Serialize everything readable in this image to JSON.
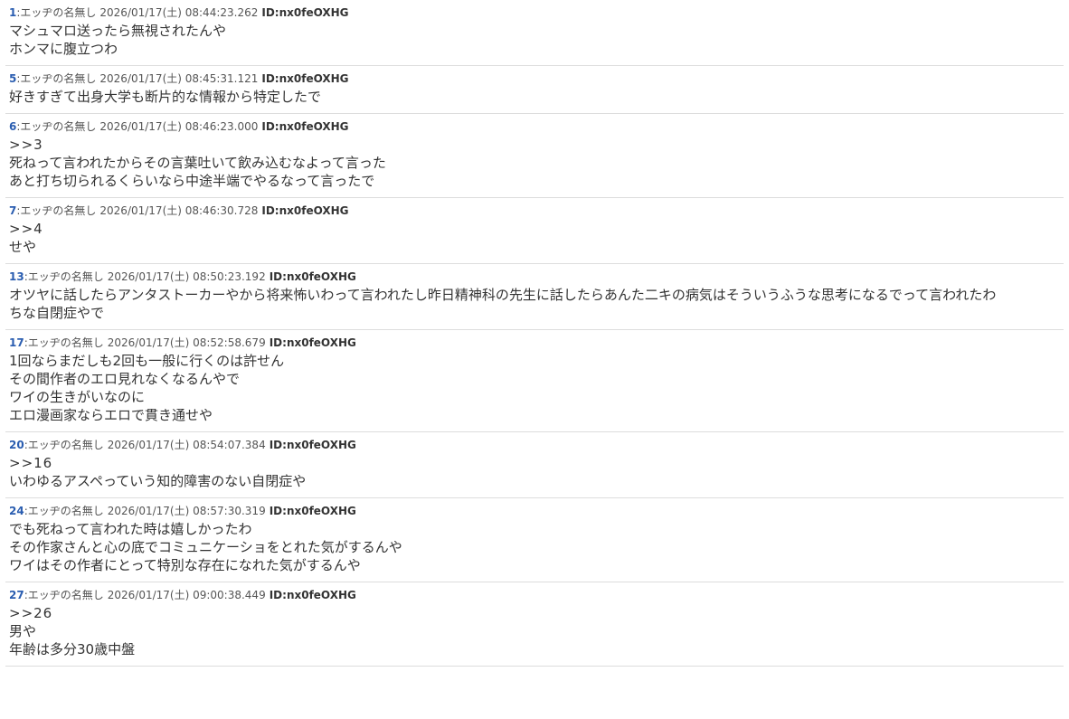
{
  "thread": {
    "posts": [
      {
        "number": "1",
        "name": ":エッヂの名無し",
        "date": "2026/01/17(土) 08:44:23.262",
        "id": "ID:nx0feOXHG",
        "lines": [
          "マシュマロ送ったら無視されたんや",
          "ホンマに腹立つわ"
        ]
      },
      {
        "number": "5",
        "name": ":エッヂの名無し",
        "date": "2026/01/17(土) 08:45:31.121",
        "id": "ID:nx0feOXHG",
        "lines": [
          "好きすぎて出身大学も断片的な情報から特定したで"
        ]
      },
      {
        "number": "6",
        "name": ":エッヂの名無し",
        "date": "2026/01/17(土) 08:46:23.000",
        "id": "ID:nx0feOXHG",
        "lines": [
          ">>3",
          "死ねって言われたからその言葉吐いて飲み込むなよって言った",
          "あと打ち切られるくらいなら中途半端でやるなって言ったで"
        ]
      },
      {
        "number": "7",
        "name": ":エッヂの名無し",
        "date": "2026/01/17(土) 08:46:30.728",
        "id": "ID:nx0feOXHG",
        "lines": [
          ">>4",
          "せや"
        ]
      },
      {
        "number": "13",
        "name": ":エッヂの名無し",
        "date": "2026/01/17(土) 08:50:23.192",
        "id": "ID:nx0feOXHG",
        "lines": [
          "オツヤに話したらアンタストーカーやから将来怖いわって言われたし昨日精神科の先生に話したらあんた二キの病気はそういうふうな思考になるでって言われたわ",
          "ちな自閉症やで"
        ]
      },
      {
        "number": "17",
        "name": ":エッヂの名無し",
        "date": "2026/01/17(土) 08:52:58.679",
        "id": "ID:nx0feOXHG",
        "lines": [
          "1回ならまだしも2回も一般に行くのは許せん",
          "その間作者のエロ見れなくなるんやで",
          "ワイの生きがいなのに",
          "エロ漫画家ならエロで貫き通せや"
        ]
      },
      {
        "number": "20",
        "name": ":エッヂの名無し",
        "date": "2026/01/17(土) 08:54:07.384",
        "id": "ID:nx0feOXHG",
        "lines": [
          ">>16",
          "いわゆるアスペっていう知的障害のない自閉症や"
        ]
      },
      {
        "number": "24",
        "name": ":エッヂの名無し",
        "date": "2026/01/17(土) 08:57:30.319",
        "id": "ID:nx0feOXHG",
        "lines": [
          "でも死ねって言われた時は嬉しかったわ",
          "その作家さんと心の底でコミュニケーショをとれた気がするんや",
          "ワイはその作者にとって特別な存在になれた気がするんや"
        ]
      },
      {
        "number": "27",
        "name": ":エッヂの名無し",
        "date": "2026/01/17(土) 09:00:38.449",
        "id": "ID:nx0feOXHG",
        "lines": [
          ">>26",
          "男や",
          "年齢は多分30歳中盤"
        ]
      }
    ]
  }
}
